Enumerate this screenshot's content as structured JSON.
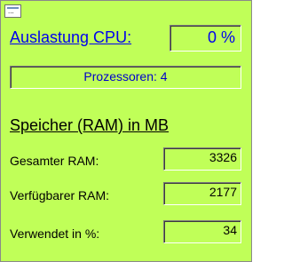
{
  "window": {
    "menu_icon": "system-menu-icon",
    "menu_dots": "...",
    "background": "#c0ff58"
  },
  "cpu": {
    "label": "Auslastung CPU:",
    "value": "0 %"
  },
  "processors": {
    "text": "Prozessoren: 4"
  },
  "memory": {
    "title": "Speicher (RAM) in MB",
    "rows": [
      {
        "label": "Gesamter RAM:",
        "value": "3326"
      },
      {
        "label": "Verfügbarer RAM:",
        "value": "2177"
      },
      {
        "label": "Verwendet in %:",
        "value": "34"
      }
    ]
  },
  "colors": {
    "link_blue": "#0000ee",
    "text_blue": "#0000cc"
  }
}
